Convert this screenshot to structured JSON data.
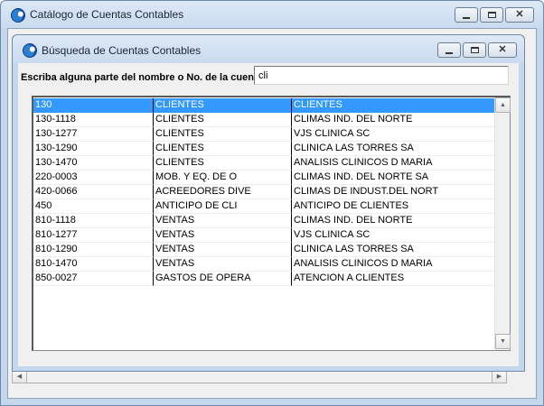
{
  "outer_window": {
    "title": "Catálogo de Cuentas Contables"
  },
  "inner_window": {
    "title": "Búsqueda de Cuentas Contables"
  },
  "search": {
    "label": "Escriba alguna parte del nombre o No. de la cuenta",
    "value": "cli"
  },
  "results": {
    "rows": [
      {
        "code": "130",
        "name": "CLIENTES",
        "description": "CLIENTES",
        "selected": true
      },
      {
        "code": "130-1118",
        "name": "CLIENTES",
        "description": "CLIMAS IND. DEL NORTE"
      },
      {
        "code": "130-1277",
        "name": "CLIENTES",
        "description": "VJS CLINICA SC"
      },
      {
        "code": "130-1290",
        "name": "CLIENTES",
        "description": "CLINICA LAS TORRES SA"
      },
      {
        "code": "130-1470",
        "name": "CLIENTES",
        "description": "ANALISIS CLINICOS D MARIA"
      },
      {
        "code": "220-0003",
        "name": "MOB. Y EQ. DE O",
        "description": "CLIMAS IND. DEL NORTE SA"
      },
      {
        "code": "420-0066",
        "name": "ACREEDORES DIVE",
        "description": "CLIMAS DE INDUST.DEL NORT"
      },
      {
        "code": "450",
        "name": "ANTICIPO DE CLI",
        "description": "ANTICIPO DE CLIENTES"
      },
      {
        "code": "810-1118",
        "name": "VENTAS",
        "description": "CLIMAS IND. DEL NORTE"
      },
      {
        "code": "810-1277",
        "name": "VENTAS",
        "description": "VJS CLINICA SC"
      },
      {
        "code": "810-1290",
        "name": "VENTAS",
        "description": "CLINICA LAS TORRES SA"
      },
      {
        "code": "810-1470",
        "name": "VENTAS",
        "description": "ANALISIS CLINICOS D MARIA"
      },
      {
        "code": "850-0027",
        "name": "GASTOS DE OPERA",
        "description": "ATENCION A CLIENTES"
      }
    ]
  },
  "icons": {
    "app": "app-logo-icon",
    "minimize": "minimize-icon",
    "maximize": "maximize-icon",
    "close": "close-icon",
    "scroll_up": "scroll-up-arrow-icon",
    "scroll_down": "scroll-down-arrow-icon",
    "scroll_left": "scroll-left-arrow-icon",
    "scroll_right": "scroll-right-arrow-icon"
  },
  "colors": {
    "selection": "#3399ff",
    "titlebar": "#c9dbef"
  }
}
